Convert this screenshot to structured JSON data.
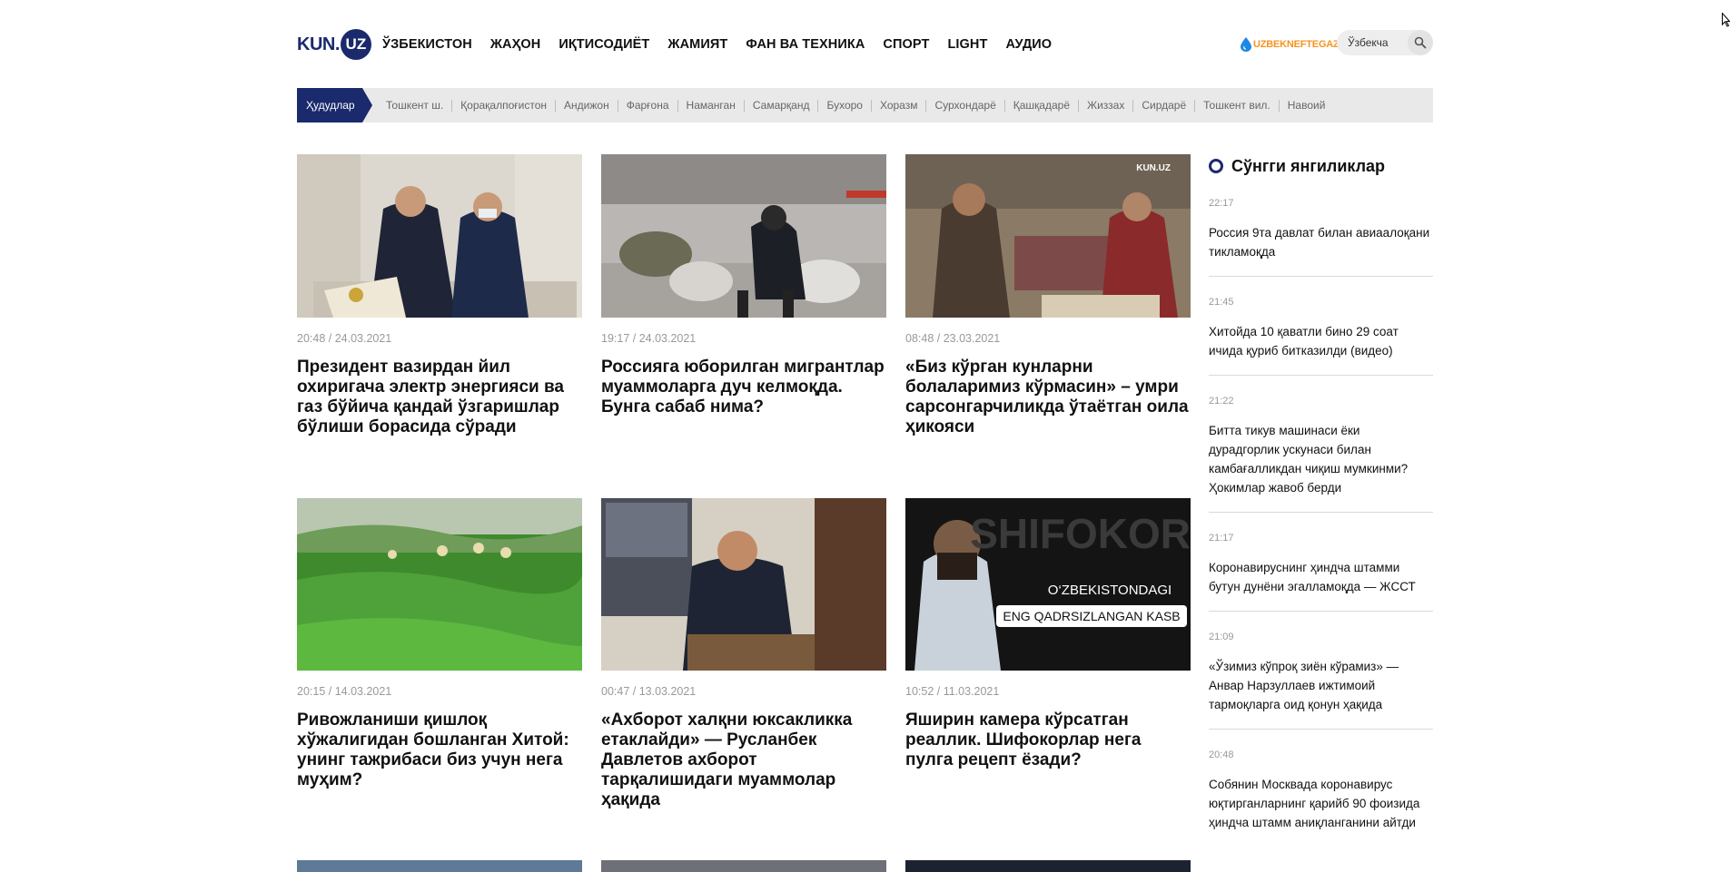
{
  "header": {
    "logo_text": "KUN.",
    "logo_circle": "UZ",
    "nav": [
      "ЎЗБЕКИСТОН",
      "ЖАҲОН",
      "ИҚТИСОДИЁТ",
      "ЖАМИЯТ",
      "ФАН ВА ТЕХНИКА",
      "СПОРТ",
      "LIGHT",
      "АУДИО"
    ],
    "sponsor": "UZBEKNEFTEGAZ",
    "language": "Ўзбекча"
  },
  "regions": {
    "label": "Ҳудудлар",
    "items": [
      "Тошкент ш.",
      "Қорақалпоғистон",
      "Андижон",
      "Фарғона",
      "Наманган",
      "Самарқанд",
      "Бухоро",
      "Хоразм",
      "Сурхондарё",
      "Қашқадарё",
      "Жиззах",
      "Сирдарё",
      "Тошкент вил.",
      "Навоий"
    ]
  },
  "articles": [
    {
      "date": "20:48 / 24.03.2021",
      "title": "Президент вазирдан йил охиригача электр энергияси ва газ бўйича қандай ўзгаришлар бўлиши борасида сўради"
    },
    {
      "date": "19:17 / 24.03.2021",
      "title": "Россияга юборилган мигрантлар муаммоларга дуч келмоқда. Бунга сабаб нима?"
    },
    {
      "date": "08:48 / 23.03.2021",
      "title": "«Биз кўрган кунларни болаларимиз кўрмасин» – умри сарсонгарчиликда ўтаётган оила ҳикояси",
      "watermark": "KUN.UZ"
    },
    {
      "date": "20:15 / 14.03.2021",
      "title": "Ривожланиши қишлоқ хўжалигидан бошланган Хитой: унинг тажрибаси биз учун нега муҳим?"
    },
    {
      "date": "00:47 / 13.03.2021",
      "title": "«Ахборот халқни юксакликка етаклайди» — Русланбек Давлетов ахборот тарқалишидаги муаммолар ҳақида"
    },
    {
      "date": "10:52 / 11.03.2021",
      "title": "Яширин камера кўрсатган реаллик. Шифокорлар нега пулга рецепт ёзади?",
      "overlay_big": "SHIFOKOR",
      "overlay_line1": "O‘ZBEKISTONDAGI",
      "overlay_line2": "ENG QADRSIZLANGAN KASB"
    }
  ],
  "sidebar": {
    "title": "Сўнгги янгиликлар",
    "items": [
      {
        "time": "22:17",
        "text": "Россия 9та давлат билан авиаалоқани тикламоқда"
      },
      {
        "time": "21:45",
        "text": "Хитойда 10 қаватли бино 29 соат ичида қуриб битказилди (видео)"
      },
      {
        "time": "21:22",
        "text": "Битта тикув машинаси ёки дурадгорлик ускунаси билан камбағалликдан чиқиш мумкинми? Ҳокимлар жавоб берди"
      },
      {
        "time": "21:17",
        "text": "Коронавируснинг ҳиндча штамми бутун дунёни эгалламоқда — ЖССТ"
      },
      {
        "time": "21:09",
        "text": "«Ўзимиз кўпроқ зиён кўрамиз» — Анвар Нарзуллаев ижтимоий тармоқларга оид қонун ҳақида"
      },
      {
        "time": "20:48",
        "text": "Собянин Москвада коронавирус юқтирганларнинг қарийб 90 фоизида ҳиндча штамм аниқланганини айтди"
      }
    ]
  },
  "colors": {
    "brand": "#1a2a6c",
    "sponsor": "#f7931e"
  }
}
